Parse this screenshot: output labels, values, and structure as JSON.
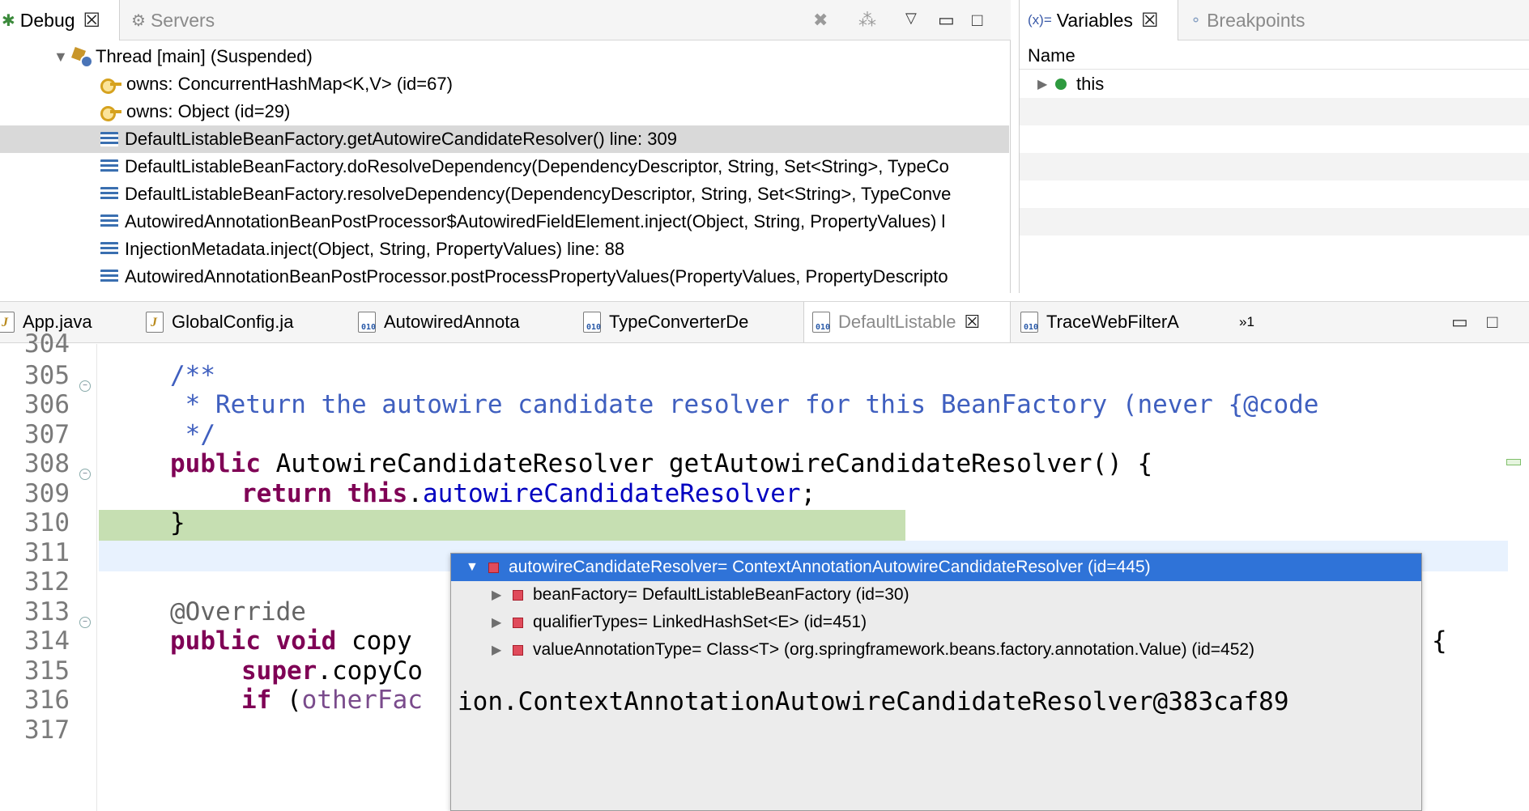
{
  "debug_view": {
    "tabs": [
      {
        "label": "Debug",
        "active": true
      },
      {
        "label": "Servers",
        "active": false
      }
    ],
    "stack": [
      {
        "text": "Thread [main] (Suspended)",
        "kind": "thread"
      },
      {
        "text": "owns: ConcurrentHashMap<K,V>  (id=67)",
        "kind": "monitor"
      },
      {
        "text": "owns: Object  (id=29)",
        "kind": "monitor"
      },
      {
        "text": "DefaultListableBeanFactory.getAutowireCandidateResolver() line: 309",
        "kind": "frame",
        "selected": true
      },
      {
        "text": "DefaultListableBeanFactory.doResolveDependency(DependencyDescriptor, String, Set<String>, TypeCo",
        "kind": "frame"
      },
      {
        "text": "DefaultListableBeanFactory.resolveDependency(DependencyDescriptor, String, Set<String>, TypeConve",
        "kind": "frame"
      },
      {
        "text": "AutowiredAnnotationBeanPostProcessor$AutowiredFieldElement.inject(Object, String, PropertyValues) l",
        "kind": "frame"
      },
      {
        "text": "InjectionMetadata.inject(Object, String, PropertyValues) line: 88",
        "kind": "frame"
      },
      {
        "text": "AutowiredAnnotationBeanPostProcessor.postProcessPropertyValues(PropertyValues, PropertyDescripto",
        "kind": "frame"
      }
    ]
  },
  "variables_view": {
    "tabs": [
      {
        "label": "Variables",
        "prefix": "(x)=",
        "active": true
      },
      {
        "label": "Breakpoints",
        "active": false
      }
    ],
    "column_header": "Name",
    "rows": [
      {
        "name": "this"
      }
    ]
  },
  "editor": {
    "tabs": [
      {
        "label": "App.java",
        "icon": "j"
      },
      {
        "label": "GlobalConfig.ja",
        "icon": "j"
      },
      {
        "label": "AutowiredAnnota",
        "icon": "class"
      },
      {
        "label": "TypeConverterDe",
        "icon": "class"
      },
      {
        "label": "DefaultListable",
        "icon": "class",
        "active": true
      },
      {
        "label": "TraceWebFilterA",
        "icon": "class"
      }
    ],
    "overflow_indicator": "»1",
    "lines": [
      {
        "num": "304",
        "text": ""
      },
      {
        "num": "305",
        "text": "/**"
      },
      {
        "num": "306",
        "text": " * Return the autowire candidate resolver for this BeanFactory (never {@code"
      },
      {
        "num": "307",
        "text": " */"
      },
      {
        "num": "308",
        "kw": "public",
        "text": " AutowireCandidateResolver getAutowireCandidateResolver() {"
      },
      {
        "num": "309",
        "kw1": "return",
        "kw2": "this",
        "dot": ".",
        "field": "autowireCandidateResolver",
        "end": ";"
      },
      {
        "num": "310",
        "text": "}"
      },
      {
        "num": "311",
        "text": ""
      },
      {
        "num": "312",
        "text": ""
      },
      {
        "num": "313",
        "text": "@Override"
      },
      {
        "num": "314",
        "kw": "public void",
        "text": " copy",
        "tail": "{"
      },
      {
        "num": "315",
        "kw": "super",
        "text": ".copyCo"
      },
      {
        "num": "316",
        "kw": "if",
        "text": " (",
        "field": "otherFac"
      },
      {
        "num": "317",
        "text": ""
      }
    ]
  },
  "hover_popup": {
    "rows": [
      {
        "text": "autowireCandidateResolver= ContextAnnotationAutowireCandidateResolver  (id=445)",
        "selected": true,
        "expanded": true
      },
      {
        "text": "beanFactory= DefaultListableBeanFactory  (id=30)"
      },
      {
        "text": "qualifierTypes= LinkedHashSet<E>  (id=451)"
      },
      {
        "text": "valueAnnotationType= Class<T> (org.springframework.beans.factory.annotation.Value) (id=452)"
      }
    ],
    "detail": "ion.ContextAnnotationAutowireCandidateResolver@383caf89"
  }
}
